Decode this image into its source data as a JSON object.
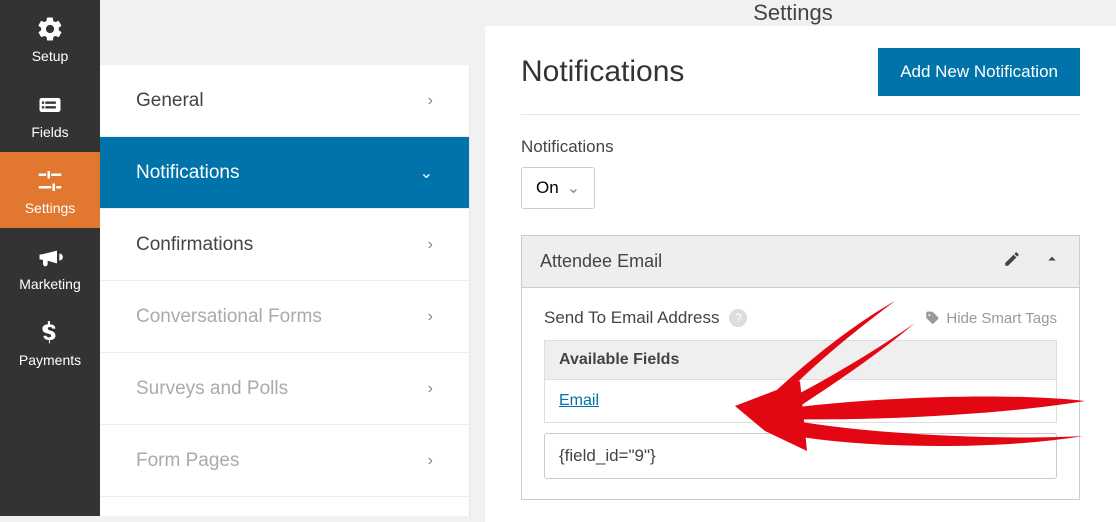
{
  "leftnav": {
    "setup": "Setup",
    "fields": "Fields",
    "settings": "Settings",
    "marketing": "Marketing",
    "payments": "Payments"
  },
  "topbar": {
    "title": "Settings"
  },
  "sidebar": {
    "general": "General",
    "notifications": "Notifications",
    "confirmations": "Confirmations",
    "conversational": "Conversational Forms",
    "surveys": "Surveys and Polls",
    "formpages": "Form Pages"
  },
  "page": {
    "title": "Notifications",
    "add_button": "Add New Notification",
    "status_label": "Notifications",
    "status_value": "On"
  },
  "panel": {
    "title": "Attendee Email",
    "sendto_label": "Send To Email Address",
    "hide_tags": "Hide Smart Tags",
    "available_fields": "Available Fields",
    "email_link": "Email",
    "input_value": "{field_id=\"9\"}"
  }
}
